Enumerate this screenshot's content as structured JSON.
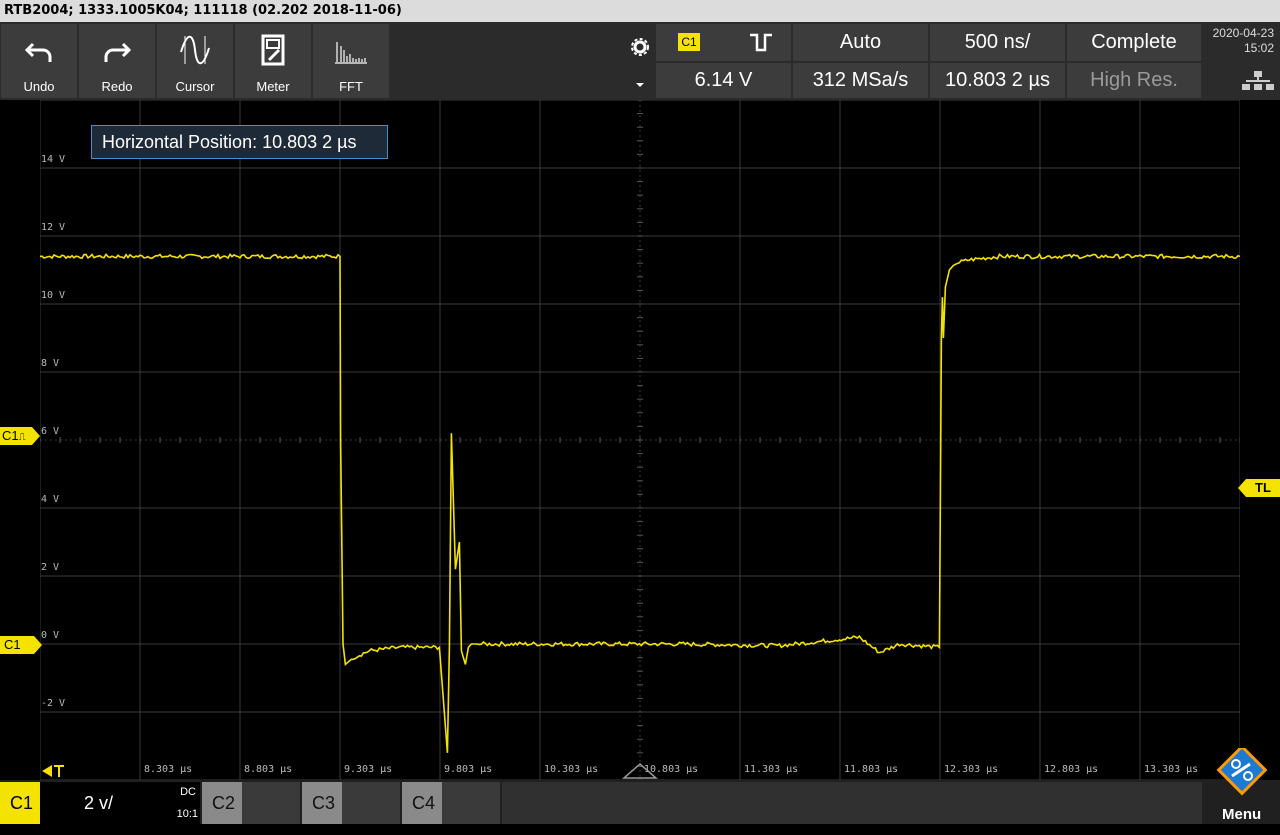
{
  "title": "RTB2004; 1333.1005K04; 111118 (02.202 2018-11-06)",
  "toolbar": {
    "buttons": [
      {
        "label": "Undo",
        "icon": "undo-icon"
      },
      {
        "label": "Redo",
        "icon": "redo-icon"
      },
      {
        "label": "Cursor",
        "icon": "cursor-icon"
      },
      {
        "label": "Meter",
        "icon": "meter-icon"
      },
      {
        "label": "FFT",
        "icon": "fft-icon"
      }
    ]
  },
  "trigger": {
    "channel": "C1",
    "mode": "Auto",
    "level": "6.14 V",
    "slope_icon": "rising-edge-icon"
  },
  "timebase": {
    "scale": "500 ns/",
    "sample_rate": "312 MSa/s",
    "position": "10.803 2 µs"
  },
  "acquisition": {
    "state": "Complete",
    "mode": "High Res."
  },
  "datetime": {
    "date": "2020-04-23",
    "time": "15:02"
  },
  "info_box": "Horizontal Position: 10.803 2 µs",
  "markers": {
    "trigger_channel": "C1",
    "trigger_glyph": "⎍",
    "ground_channel": "C1",
    "trigger_level": "TL"
  },
  "status_bar": {
    "channel": "C1",
    "scale": "2 v/",
    "coupling": "DC",
    "probe": "10:1",
    "other_channels": [
      "C2",
      "C3",
      "C4"
    ],
    "menu": "Menu"
  },
  "colors": {
    "trace": "#f4e300",
    "grid": "#3a3a3a",
    "accent": "#4c8ccc"
  },
  "chart_data": {
    "type": "line",
    "xlabel": "",
    "ylabel": "",
    "y_ticks": [
      "14 V",
      "12 V",
      "10 V",
      "8 V",
      "6 V",
      "4 V",
      "2 V",
      "0 V",
      "-2 V"
    ],
    "x_ticks": [
      "8.303 µs",
      "8.803 µs",
      "9.303 µs",
      "9.803 µs",
      "10.303 µs",
      "10.803 µs",
      "11.303 µs",
      "11.803 µs",
      "12.303 µs",
      "12.803 µs",
      "13.303 µs"
    ],
    "xlim": [
      7.803,
      13.803
    ],
    "ylim": [
      -4,
      16
    ],
    "series": [
      {
        "x": [
          7.803,
          9.303,
          9.306,
          9.318,
          9.33,
          9.37,
          9.45,
          9.6,
          9.8,
          9.84,
          9.85,
          9.86,
          9.88,
          9.9,
          9.91,
          9.93,
          9.945,
          9.96,
          10.0,
          10.5,
          11.0,
          11.5,
          11.9,
          12.0,
          12.1,
          12.3,
          12.31,
          12.315,
          12.32,
          12.33,
          12.35,
          12.38,
          12.45,
          12.6,
          13.803
        ],
        "y": [
          11.4,
          11.4,
          6.0,
          0.0,
          -0.6,
          -0.4,
          -0.2,
          -0.1,
          -0.1,
          -3.2,
          -0.1,
          6.2,
          2.2,
          3.0,
          -0.2,
          -0.6,
          -0.1,
          0.0,
          0.0,
          0.0,
          0.0,
          -0.05,
          0.2,
          -0.25,
          0.0,
          -0.1,
          9.0,
          10.2,
          9.0,
          10.5,
          11.0,
          11.2,
          11.3,
          11.4,
          11.4
        ]
      }
    ]
  }
}
